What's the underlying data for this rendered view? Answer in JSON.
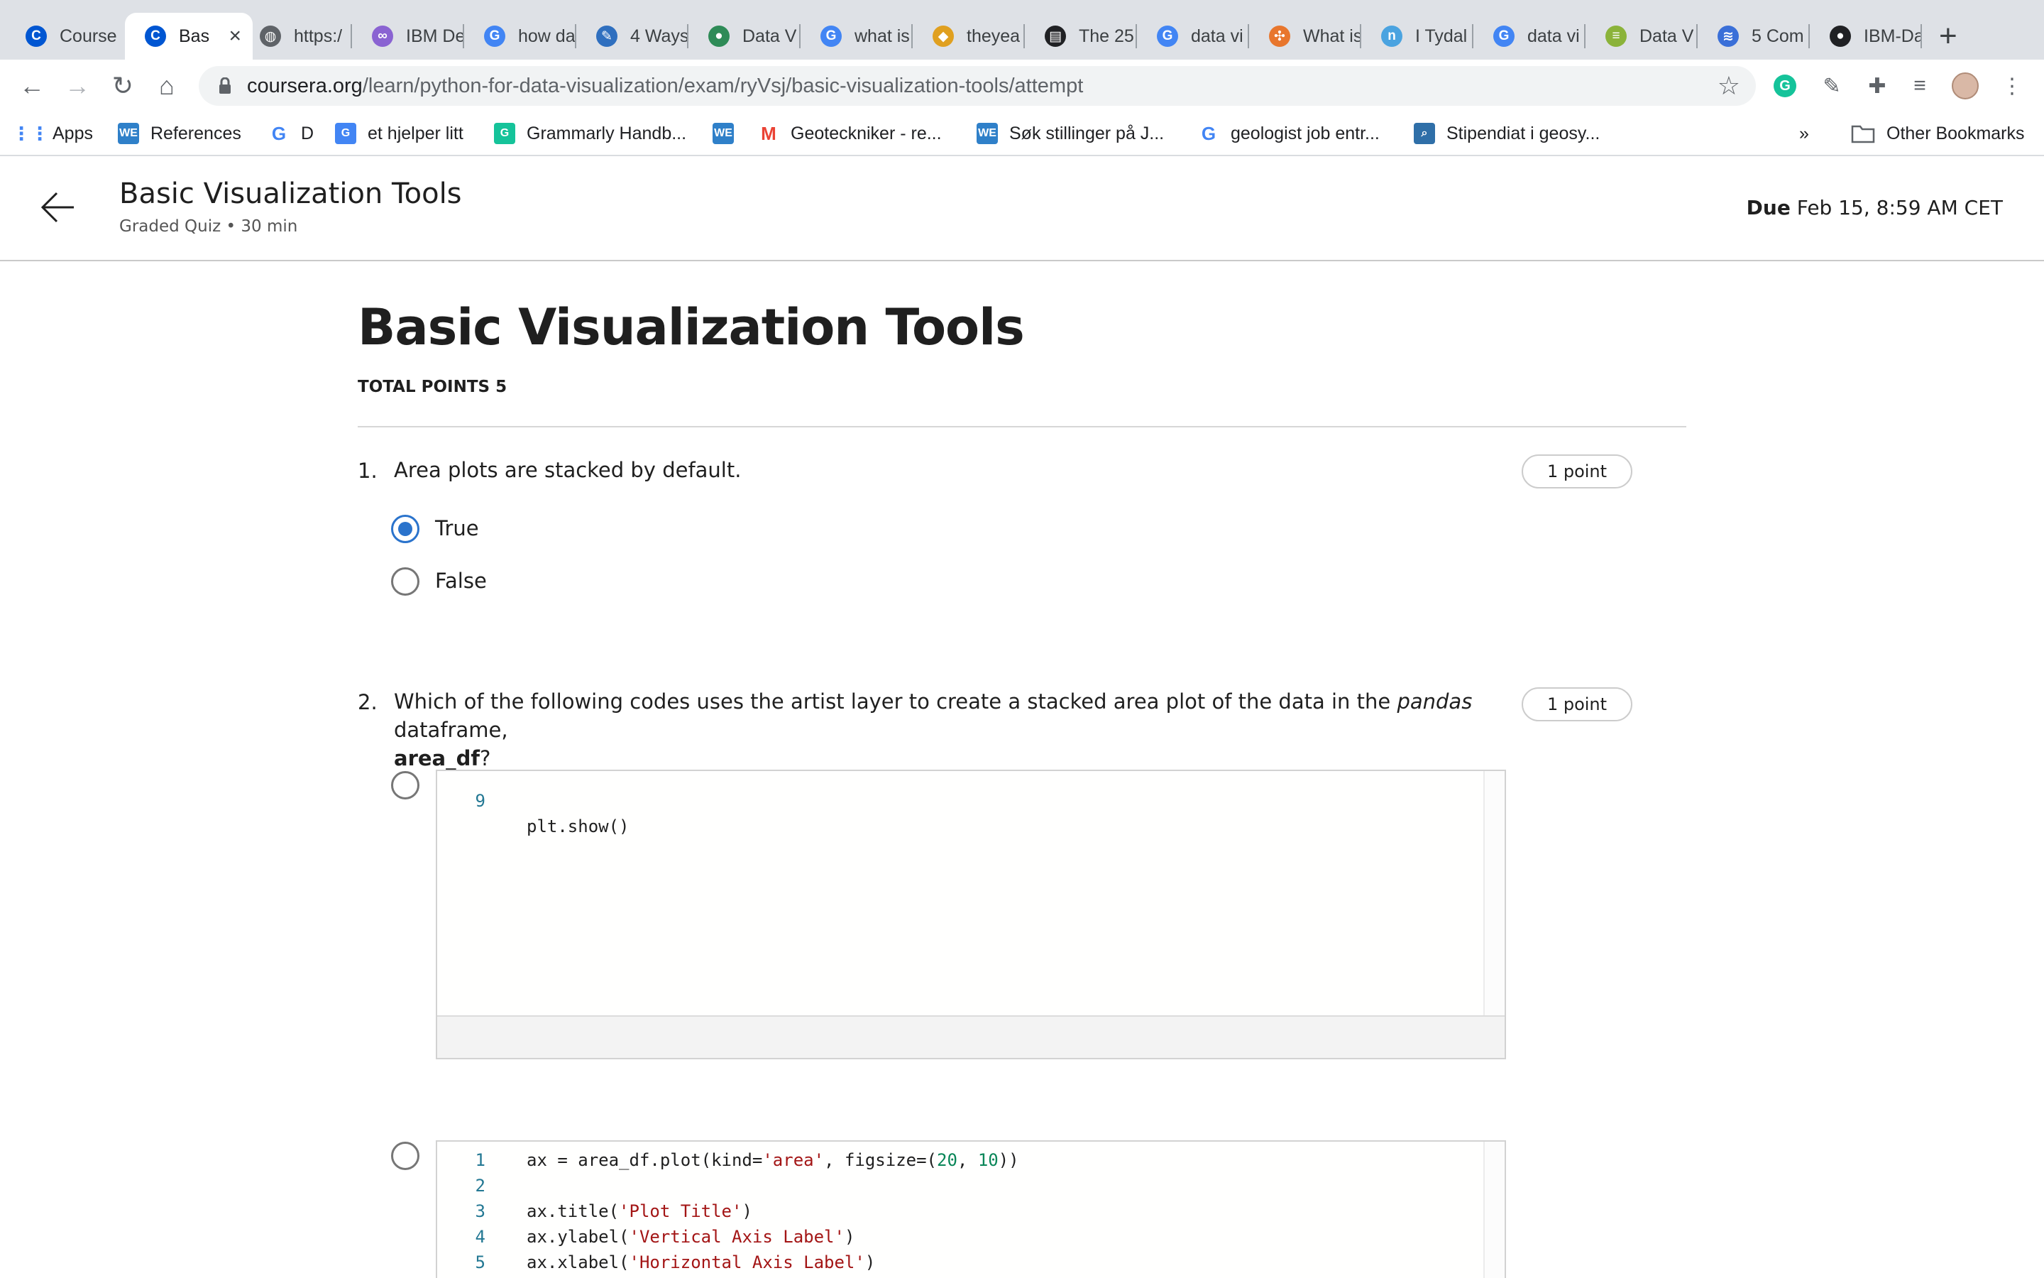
{
  "browser": {
    "tabs": [
      {
        "label": "Course",
        "icon": "coursera-icon",
        "color": "#0056d2",
        "glyph": "C"
      },
      {
        "label": "Bas",
        "icon": "coursera-icon",
        "color": "#0056d2",
        "glyph": "C",
        "active": true
      },
      {
        "label": "https:/",
        "icon": "globe-icon",
        "color": "#5f6368",
        "glyph": "◍"
      },
      {
        "label": "IBM De",
        "icon": "ibm-icon",
        "color": "#8a63d2",
        "glyph": "∞"
      },
      {
        "label": "how da",
        "icon": "google-icon",
        "color": "#4285f4",
        "glyph": "G"
      },
      {
        "label": "4 Ways",
        "icon": "feather-icon",
        "color": "#2f6fbf",
        "glyph": "✎"
      },
      {
        "label": "Data V",
        "icon": "globe-colored-icon",
        "color": "#2e8b57",
        "glyph": "●"
      },
      {
        "label": "what is",
        "icon": "google-icon",
        "color": "#4285f4",
        "glyph": "G"
      },
      {
        "label": "theyea",
        "icon": "cube-icon",
        "color": "#e0a020",
        "glyph": "◆"
      },
      {
        "label": "The 25",
        "icon": "chart-icon",
        "color": "#202124",
        "glyph": "▤"
      },
      {
        "label": "data vi",
        "icon": "google-icon",
        "color": "#4285f4",
        "glyph": "G"
      },
      {
        "label": "What is",
        "icon": "tableau-icon",
        "color": "#e8762d",
        "glyph": "✣"
      },
      {
        "label": "I Tydal",
        "icon": "nrk-icon",
        "color": "#4aa3e0",
        "glyph": "n"
      },
      {
        "label": "data vi",
        "icon": "google-icon",
        "color": "#4285f4",
        "glyph": "G"
      },
      {
        "label": "Data V",
        "icon": "bars-icon",
        "color": "#8bb33a",
        "glyph": "≡"
      },
      {
        "label": "5 Com",
        "icon": "stripes-icon",
        "color": "#3a6fd8",
        "glyph": "≋"
      },
      {
        "label": "IBM-Da",
        "icon": "github-icon",
        "color": "#202124",
        "glyph": "●"
      }
    ],
    "new_tab_glyph": "+",
    "url_host": "coursera.org",
    "url_path": "/learn/python-for-data-visualization/exam/ryVsj/basic-visualization-tools/attempt",
    "bookmarks": [
      {
        "label": "Apps",
        "icon": "apps-grid-icon",
        "color": "#4285f4",
        "glyph": "⋮⋮"
      },
      {
        "label": "References",
        "icon": "we-icon",
        "color": "#2f80c9",
        "glyph": "WE"
      },
      {
        "label": "D",
        "icon": "google-icon",
        "color": "#4285f4",
        "glyph": "G"
      },
      {
        "label": "et hjelper litt",
        "icon": "translate-icon",
        "color": "#4285f4",
        "glyph": "G"
      },
      {
        "label": "Grammarly Handb...",
        "icon": "grammarly-icon",
        "color": "#15c39a",
        "glyph": "G"
      },
      {
        "label": "",
        "icon": "we-icon",
        "color": "#2f80c9",
        "glyph": "WE"
      },
      {
        "label": "Geoteckniker - re...",
        "icon": "gmail-icon",
        "color": "#ea4335",
        "glyph": "M"
      },
      {
        "label": "Søk stillinger på J...",
        "icon": "we-icon",
        "color": "#2f80c9",
        "glyph": "WE"
      },
      {
        "label": "geologist job entr...",
        "icon": "google-icon",
        "color": "#4285f4",
        "glyph": "G"
      },
      {
        "label": "Stipendiat i geosy...",
        "icon": "search-square-icon",
        "color": "#2f6fa8",
        "glyph": "⌕"
      }
    ],
    "bookmarks_overflow": "»",
    "other_bookmarks": "Other Bookmarks"
  },
  "header": {
    "title": "Basic Visualization Tools",
    "subtitle": "Graded Quiz • 30 min",
    "due_label": "Due",
    "due_value": "Feb 15, 8:59 AM CET"
  },
  "quiz": {
    "title": "Basic Visualization Tools",
    "total_points": "TOTAL POINTS 5",
    "q1": {
      "number": "1.",
      "text": "Area plots are stacked by default.",
      "points": "1 point",
      "options": [
        "True",
        "False"
      ],
      "selected": "True"
    },
    "q2": {
      "number": "2.",
      "text_before": "Which of the following codes uses the artist layer to create a stacked area plot of the data in the ",
      "text_em": "pandas",
      "text_mid": " dataframe,",
      "text_bold": "area_df",
      "text_after": "?",
      "points": "1 point",
      "option_a_visible_line": {
        "n": "9",
        "code": "plt.show()"
      },
      "option_b_lines": [
        {
          "n": "1",
          "code": "ax = area_df.plot(kind='area', figsize=(20, 10))"
        },
        {
          "n": "2",
          "code": ""
        },
        {
          "n": "3",
          "code": "ax.title('Plot Title')"
        },
        {
          "n": "4",
          "code": "ax.ylabel('Vertical Axis Label')"
        },
        {
          "n": "5",
          "code": "ax.xlabel('Horizontal Axis Label')"
        }
      ]
    }
  },
  "colors": {
    "accent": "#2a73cc",
    "text": "#1f1f1f",
    "string_literal": "#a31515",
    "number_literal": "#098658",
    "line_number": "#237893"
  }
}
